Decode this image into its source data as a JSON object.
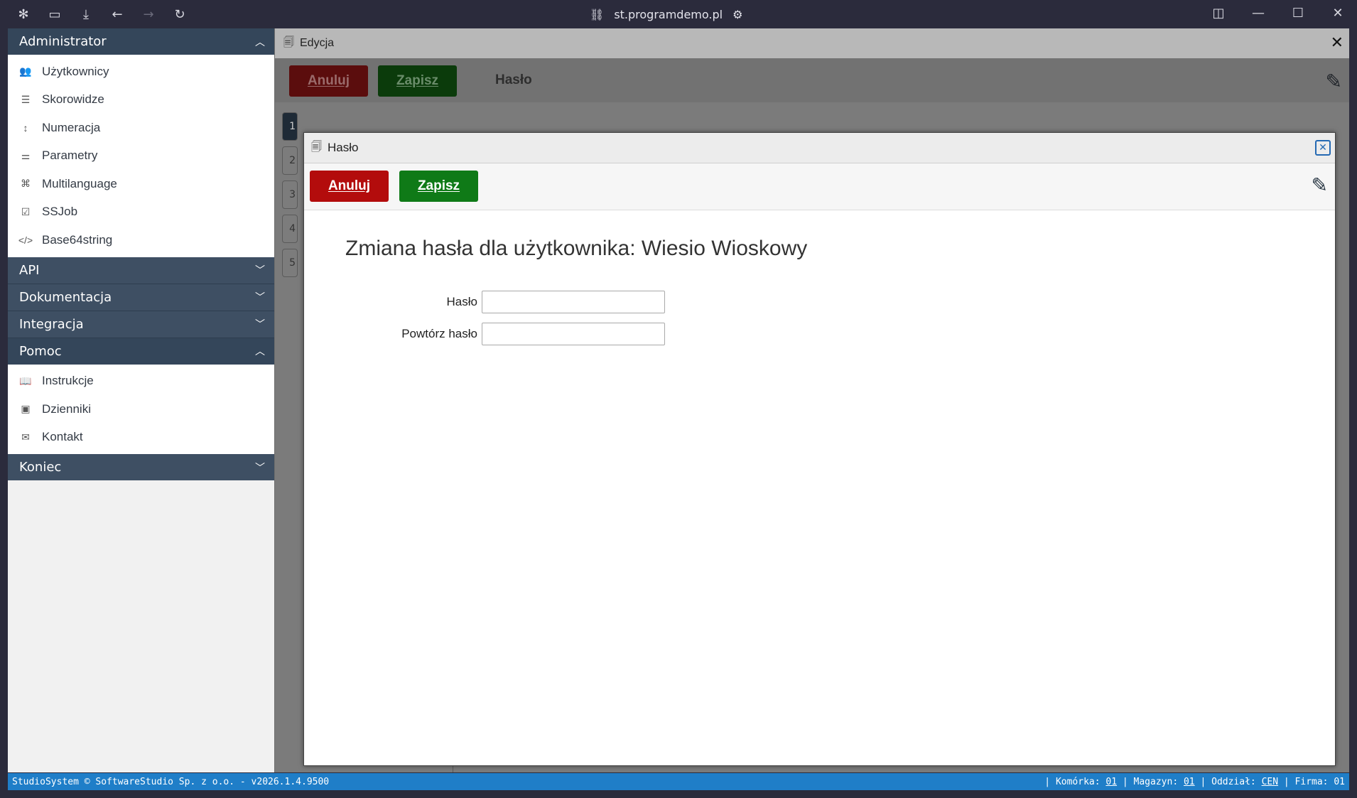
{
  "browser": {
    "url": "st.programdemo.pl"
  },
  "sidebar": {
    "sections": [
      {
        "title": "Administrator",
        "expanded": true,
        "items": [
          {
            "label": "Użytkownicy",
            "icon": "users-icon"
          },
          {
            "label": "Skorowidze",
            "icon": "list-icon"
          },
          {
            "label": "Numeracja",
            "icon": "sort-numeric-icon"
          },
          {
            "label": "Parametry",
            "icon": "sliders-icon"
          },
          {
            "label": "Multilanguage",
            "icon": "language-icon"
          },
          {
            "label": "SSJob",
            "icon": "checklist-icon"
          },
          {
            "label": "Base64string",
            "icon": "code-icon"
          }
        ]
      },
      {
        "title": "API",
        "expanded": false
      },
      {
        "title": "Dokumentacja",
        "expanded": false
      },
      {
        "title": "Integracja",
        "expanded": false
      },
      {
        "title": "Pomoc",
        "expanded": true,
        "items": [
          {
            "label": "Instrukcje",
            "icon": "book-icon"
          },
          {
            "label": "Dzienniki",
            "icon": "journal-icon"
          },
          {
            "label": "Kontakt",
            "icon": "inbox-icon"
          }
        ]
      },
      {
        "title": "Koniec",
        "expanded": false
      }
    ]
  },
  "edycja": {
    "title": "Edycja",
    "cancel": "Anuluj",
    "save": "Zapisz",
    "label": "Hasło",
    "tabs": [
      "1",
      "2",
      "3",
      "4",
      "5"
    ]
  },
  "modal": {
    "title": "Hasło",
    "cancel": "Anuluj",
    "save": "Zapisz",
    "heading": "Zmiana hasła dla użytkownika: Wiesio Wioskowy",
    "fields": [
      {
        "label": "Hasło",
        "value": ""
      },
      {
        "label": "Powtórz hasło",
        "value": ""
      }
    ]
  },
  "status": {
    "left": "StudioSystem © SoftwareStudio Sp. z o.o. - v2026.1.4.9500",
    "komorka_label": "Komórka:",
    "komorka": "01",
    "magazyn_label": "Magazyn:",
    "magazyn": "01",
    "oddzial_label": "Oddział:",
    "oddzial": "CEN",
    "firma_label": "Firma:",
    "firma": "01"
  },
  "colors": {
    "sidebar_header": "#3e4f63",
    "cancel_red": "#b30c0c",
    "save_green": "#0f7a17",
    "status_bar": "#1f7ec8"
  }
}
